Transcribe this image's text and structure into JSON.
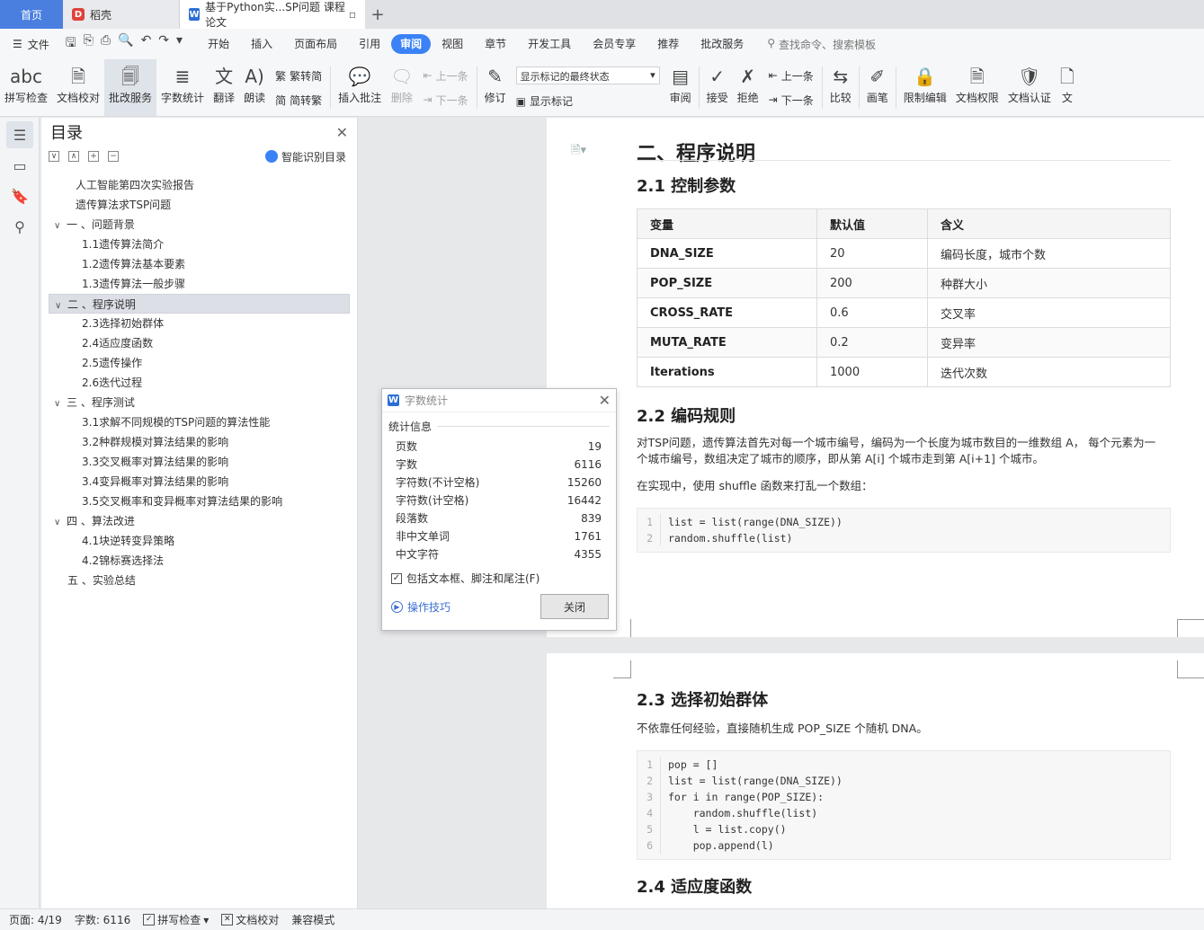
{
  "tabs": {
    "home": "首页",
    "daoke": "稻壳",
    "doc": "基于Python实...SP问题 课程论文",
    "new": "+"
  },
  "menu": {
    "file": "文件",
    "tabs": [
      "开始",
      "插入",
      "页面布局",
      "引用",
      "审阅",
      "视图",
      "章节",
      "开发工具",
      "会员专享",
      "推荐",
      "批改服务"
    ],
    "active_tab": "审阅",
    "search": "查找命令、搜索模板"
  },
  "ribbon": {
    "spellcheck": "拼写检查",
    "doc_check": "文档校对",
    "review_service": "批改服务",
    "word_count": "字数统计",
    "translate": "翻译",
    "read_aloud": "朗读",
    "trad": "繁转简",
    "simp": "简转繁",
    "insert_comment": "插入批注",
    "delete": "删除",
    "prev": "上一条",
    "next": "下一条",
    "track": "修订",
    "markup_select": "显示标记的最终状态",
    "show_markup": "显示标记",
    "review": "审阅",
    "accept": "接受",
    "reject": "拒绝",
    "prev2": "上一条",
    "next2": "下一条",
    "compare": "比较",
    "pen": "画笔",
    "restrict": "限制编辑",
    "permission": "文档权限",
    "certify": "文档认证",
    "more": "文"
  },
  "toc": {
    "title": "目录",
    "smart": "智能识别目录",
    "items": [
      {
        "text": "人工智能第四次实验报告",
        "level": "lv0"
      },
      {
        "text": "遗传算法求TSP问题",
        "level": "lv0"
      },
      {
        "text": "一 、问题背景",
        "level": "lv1",
        "chev": "∨"
      },
      {
        "text": "1.1遗传算法简介",
        "level": "lv2"
      },
      {
        "text": "1.2遗传算法基本要素",
        "level": "lv2"
      },
      {
        "text": "1.3遗传算法一般步骤",
        "level": "lv2"
      },
      {
        "text": "二 、程序说明",
        "level": "lv1 sel",
        "chev": "∨"
      },
      {
        "text": "2.3选择初始群体",
        "level": "lv2"
      },
      {
        "text": "2.4适应度函数",
        "level": "lv2"
      },
      {
        "text": "2.5遗传操作",
        "level": "lv2"
      },
      {
        "text": "2.6迭代过程",
        "level": "lv2"
      },
      {
        "text": "三 、程序测试",
        "level": "lv1",
        "chev": "∨"
      },
      {
        "text": "3.1求解不同规模的TSP问题的算法性能",
        "level": "lv2"
      },
      {
        "text": "3.2种群规模对算法结果的影响",
        "level": "lv2"
      },
      {
        "text": "3.3交叉概率对算法结果的影响",
        "level": "lv2"
      },
      {
        "text": "3.4变异概率对算法结果的影响",
        "level": "lv2"
      },
      {
        "text": "3.5交叉概率和变异概率对算法结果的影响",
        "level": "lv2"
      },
      {
        "text": "四 、算法改进",
        "level": "lv1",
        "chev": "∨"
      },
      {
        "text": "4.1块逆转变异策略",
        "level": "lv2"
      },
      {
        "text": "4.2锦标赛选择法",
        "level": "lv2"
      },
      {
        "text": "五 、实验总结",
        "level": "lv1n"
      }
    ]
  },
  "doc": {
    "h_section2": "二、程序说明",
    "h_2_1": "2.1 控制参数",
    "table_headers": [
      "变量",
      "默认值",
      "含义"
    ],
    "table_rows": [
      [
        "DNA_SIZE",
        "20",
        "编码长度，城市个数"
      ],
      [
        "POP_SIZE",
        "200",
        "种群大小"
      ],
      [
        "CROSS_RATE",
        "0.6",
        "交叉率"
      ],
      [
        "MUTA_RATE",
        "0.2",
        "变异率"
      ],
      [
        "Iterations",
        "1000",
        "迭代次数"
      ]
    ],
    "h_2_2": "2.2 编码规则",
    "p_2_2a": "对TSP问题，遗传算法首先对每一个城市编号，编码为一个长度为城市数目的一维数组 A， 每个元素为一个城市编号，数组决定了城市的顺序，即从第 A[i] 个城市走到第 A[i+1] 个城市。",
    "p_2_2b": "在实现中，使用 shuffle 函数来打乱一个数组：",
    "code1": [
      "list = list(range(DNA_SIZE))",
      "random.shuffle(list)"
    ],
    "h_2_3": "2.3 选择初始群体",
    "p_2_3": "不依靠任何经验，直接随机生成 POP_SIZE 个随机 DNA。",
    "code2": [
      "pop = []",
      "list = list(range(DNA_SIZE))",
      "for i in range(POP_SIZE):",
      "    random.shuffle(list)",
      "    l = list.copy()",
      "    pop.append(l)"
    ],
    "h_2_4": "2.4 适应度函数"
  },
  "dialog": {
    "title": "字数统计",
    "section": "统计信息",
    "stats": [
      [
        "页数",
        "19"
      ],
      [
        "字数",
        "6116"
      ],
      [
        "字符数(不计空格)",
        "15260"
      ],
      [
        "字符数(计空格)",
        "16442"
      ],
      [
        "段落数",
        "839"
      ],
      [
        "非中文单词",
        "1761"
      ],
      [
        "中文字符",
        "4355"
      ]
    ],
    "include": "包括文本框、脚注和尾注(F)",
    "tips": "操作技巧",
    "close": "关闭"
  },
  "status": {
    "page": "页面: 4/19",
    "words": "字数: 6116",
    "spell": "拼写检查",
    "proof": "文档校对",
    "compat": "兼容模式"
  },
  "colors": {
    "accent": "#3b82f6",
    "home_tab": "#4a7fe0"
  }
}
